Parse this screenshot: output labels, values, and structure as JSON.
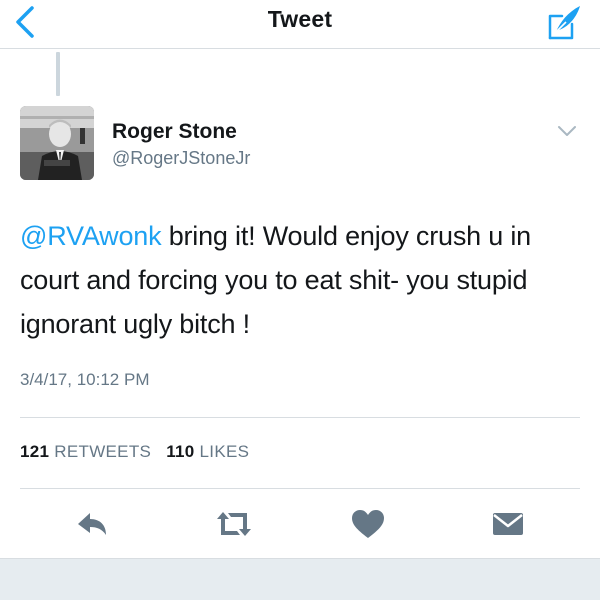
{
  "nav": {
    "title": "Tweet",
    "back_icon": "chevron-left-icon",
    "compose_icon": "compose-feather-icon",
    "accent_color": "#1da1f2"
  },
  "tweet": {
    "author": {
      "name": "Roger Stone",
      "handle": "@RogerJStoneJr"
    },
    "mention": "@RVAwonk",
    "text": " bring it! Would enjoy crush u in court and forcing you to eat shit- you stupid ignorant ugly bitch !",
    "timestamp": "3/4/17, 10:12 PM",
    "stats": {
      "retweets_count": "121",
      "retweets_label": "RETWEETS",
      "likes_count": "110",
      "likes_label": "LIKES"
    }
  },
  "actions": {
    "reply_icon": "reply-icon",
    "retweet_icon": "retweet-icon",
    "like_icon": "heart-icon",
    "dm_icon": "envelope-icon"
  }
}
